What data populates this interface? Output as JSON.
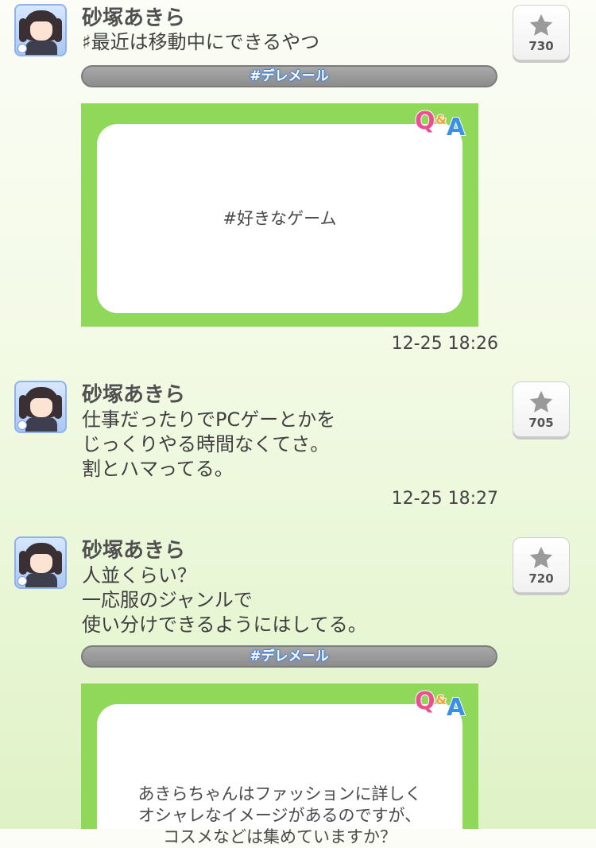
{
  "posts": [
    {
      "name": "砂塚あきら",
      "message": "♯最近は移動中にできるやつ",
      "stars": "730",
      "tag": "#デレメール",
      "card_text": "#好きなゲーム",
      "time": "12-25 18:26"
    },
    {
      "name": "砂塚あきら",
      "message": "仕事だったりでPCゲーとかを\nじっくりやる時間なくてさ。\n割とハマってる。",
      "stars": "705",
      "time": "12-25 18:27"
    },
    {
      "name": "砂塚あきら",
      "message": "人並くらい？\n一応服のジャンルで\n使い分けできるようにはしてる。",
      "stars": "720",
      "tag": "#デレメール",
      "card_text": "あきらちゃんはファッションに詳しく\nオシャレなイメージがあるのですが、\nコスメなどは集めていますか？"
    }
  ],
  "qa_logo": {
    "q": "Q",
    "amp": "&",
    "a": "A"
  },
  "colors": {
    "card_green": "#8fd85a",
    "tag_outline": "#3f7fd6",
    "q_pink": "#ec4f8f",
    "a_blue": "#3a8fe8"
  }
}
